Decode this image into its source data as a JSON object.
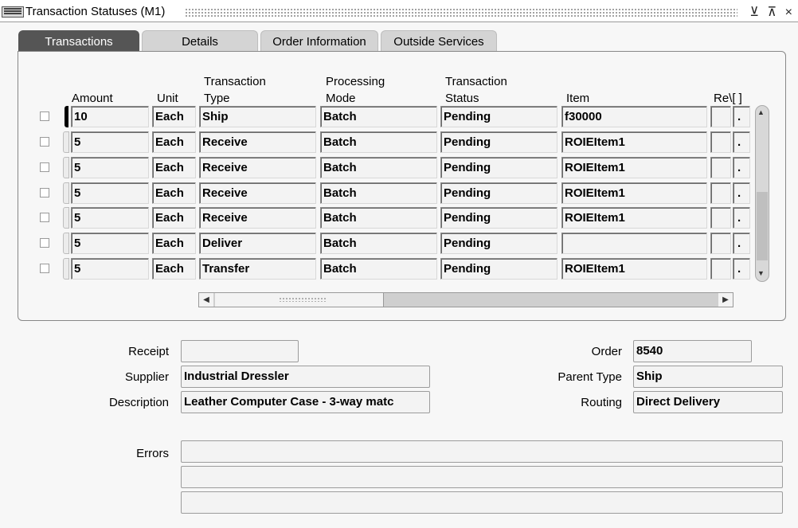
{
  "window": {
    "title": "Transaction Statuses (M1)",
    "controls": "⊻ ⊼ ×"
  },
  "tabs": [
    {
      "label": "Transactions",
      "active": true
    },
    {
      "label": "Details"
    },
    {
      "label": "Order Information"
    },
    {
      "label": "Outside Services"
    }
  ],
  "grid": {
    "headers": {
      "amount": "Amount",
      "unit": "Unit",
      "transaction_type_1": "Transaction",
      "transaction_type_2": "Type",
      "processing_mode_1": "Processing",
      "processing_mode_2": "Mode",
      "transaction_status_1": "Transaction",
      "transaction_status_2": "Status",
      "item": "Item",
      "rev": "Re\\[ ]"
    },
    "rows": [
      {
        "amount": "10",
        "unit": "Each",
        "type": "Ship",
        "mode": "Batch",
        "status": "Pending",
        "item": "f30000",
        "rev": ""
      },
      {
        "amount": "5",
        "unit": "Each",
        "type": "Receive",
        "mode": "Batch",
        "status": "Pending",
        "item": "ROIEItem1",
        "rev": ""
      },
      {
        "amount": "5",
        "unit": "Each",
        "type": "Receive",
        "mode": "Batch",
        "status": "Pending",
        "item": "ROIEItem1",
        "rev": ""
      },
      {
        "amount": "5",
        "unit": "Each",
        "type": "Receive",
        "mode": "Batch",
        "status": "Pending",
        "item": "ROIEItem1",
        "rev": ""
      },
      {
        "amount": "5",
        "unit": "Each",
        "type": "Receive",
        "mode": "Batch",
        "status": "Pending",
        "item": "ROIEItem1",
        "rev": ""
      },
      {
        "amount": "5",
        "unit": "Each",
        "type": "Deliver",
        "mode": "Batch",
        "status": "Pending",
        "item": "",
        "rev": ""
      },
      {
        "amount": "5",
        "unit": "Each",
        "type": "Transfer",
        "mode": "Batch",
        "status": "Pending",
        "item": "ROIEItem1",
        "rev": ""
      }
    ],
    "lov_glyph": "."
  },
  "form": {
    "receipt_label": "Receipt",
    "receipt_value": "",
    "supplier_label": "Supplier",
    "supplier_value": "Industrial Dressler",
    "description_label": "Description",
    "description_value": "Leather Computer Case - 3-way matc",
    "order_label": "Order",
    "order_value": "8540",
    "parent_type_label": "Parent Type",
    "parent_type_value": "Ship",
    "routing_label": "Routing",
    "routing_value": "Direct Delivery",
    "errors_label": "Errors",
    "errors": [
      "",
      "",
      ""
    ]
  }
}
